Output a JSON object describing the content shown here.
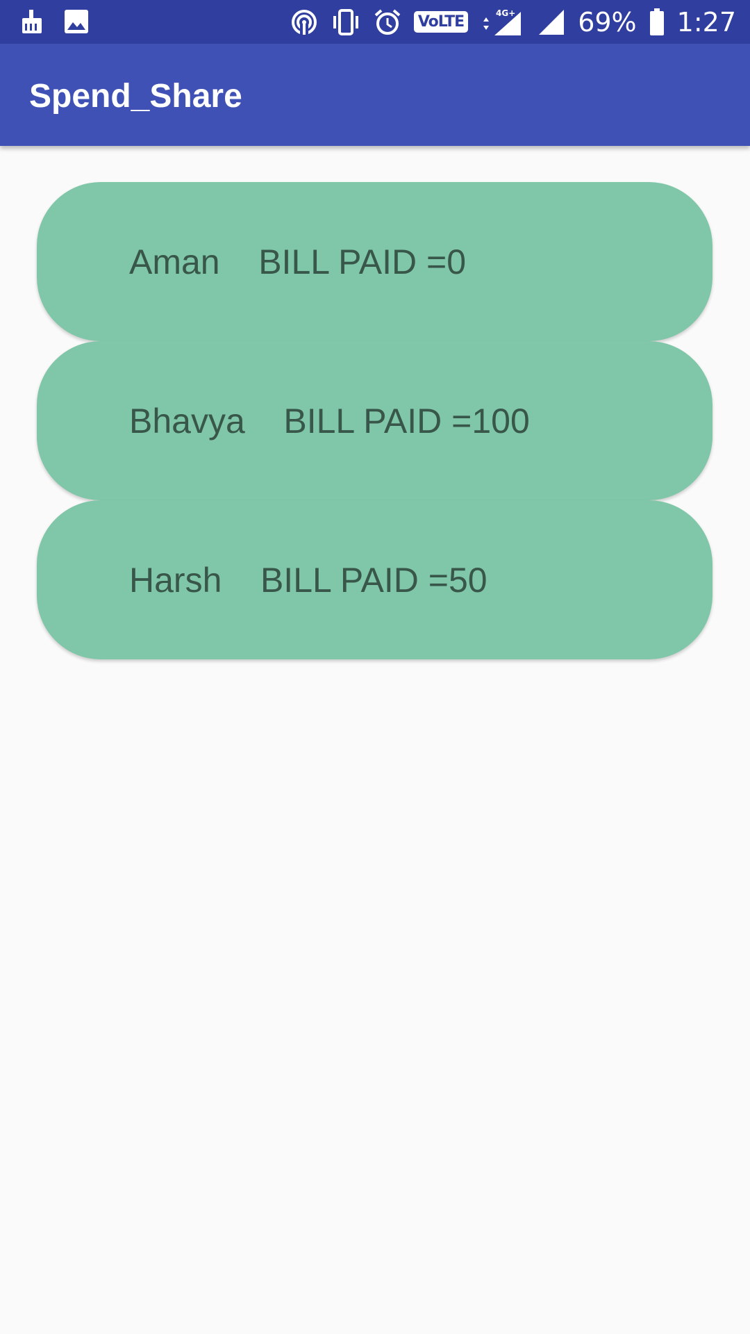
{
  "status_bar": {
    "icons_left": [
      "cleaner-icon",
      "image-icon"
    ],
    "icons_right": [
      "hotspot-icon",
      "vibrate-icon",
      "alarm-icon"
    ],
    "volte_label": "VoLTE",
    "network_label": "4G+",
    "battery_percent": "69%",
    "time": "1:27"
  },
  "app_bar": {
    "title": "Spend_Share"
  },
  "entries": [
    {
      "name": "Aman",
      "label": "BILL PAID =",
      "amount": "0"
    },
    {
      "name": "Bhavya",
      "label": "BILL PAID =",
      "amount": "100"
    },
    {
      "name": "Harsh",
      "label": "BILL PAID =",
      "amount": "50"
    }
  ],
  "colors": {
    "status_bar": "#303f9f",
    "app_bar": "#3f51b5",
    "card": "#80c6a8",
    "card_text": "#38574a",
    "background": "#fafafa"
  }
}
